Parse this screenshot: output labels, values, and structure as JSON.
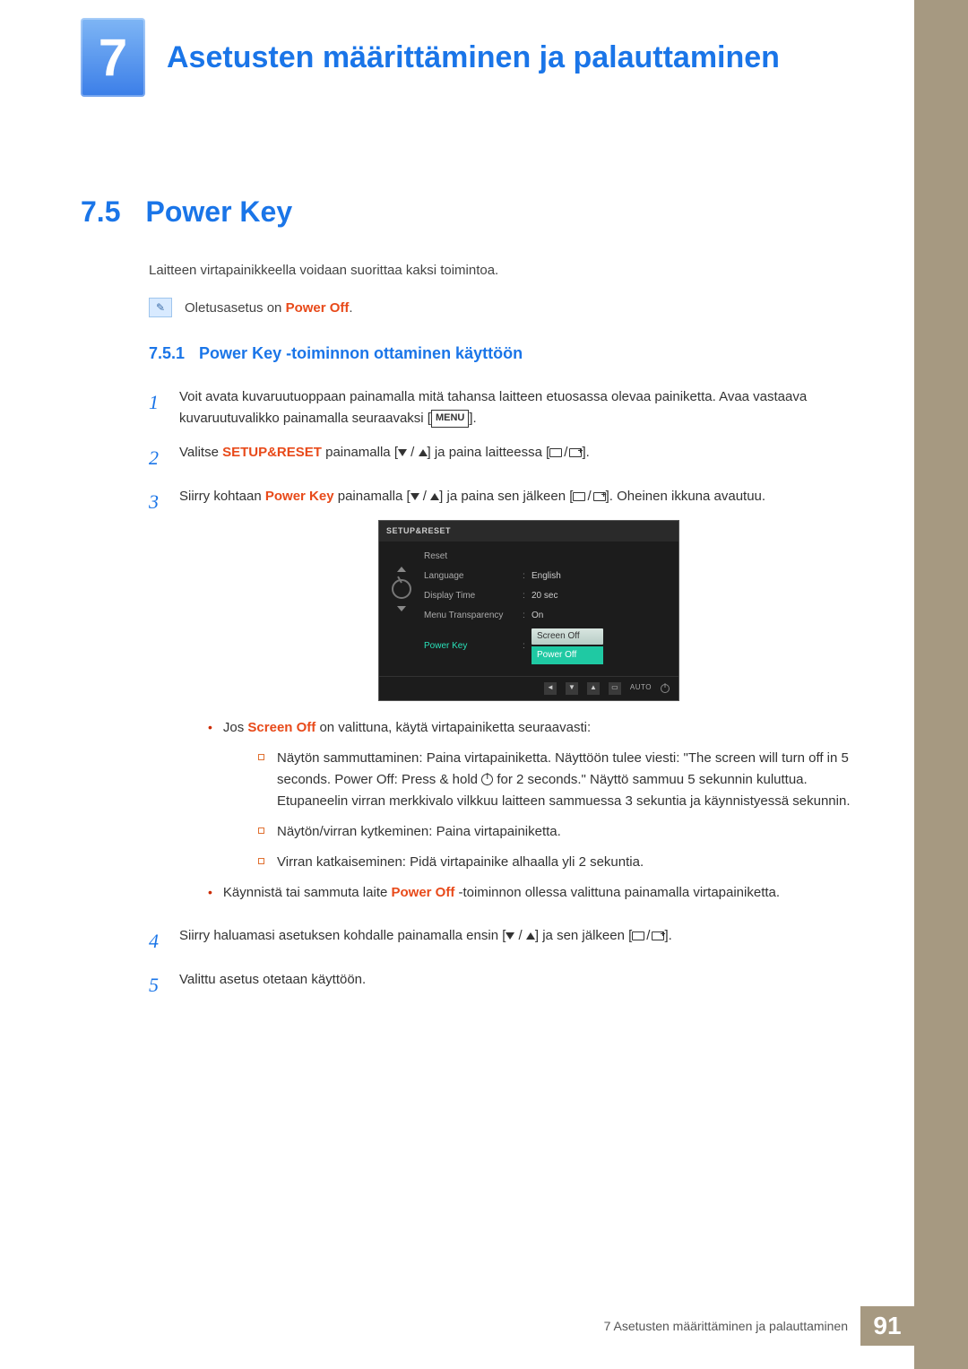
{
  "header": {
    "chapter_number": "7",
    "chapter_title": "Asetusten määrittäminen ja palauttaminen"
  },
  "section": {
    "number": "7.5",
    "title": "Power Key"
  },
  "intro_paragraph": "Laitteen virtapainikkeella voidaan suorittaa kaksi toimintoa.",
  "note": {
    "prefix": "Oletusasetus on ",
    "highlight": "Power Off",
    "suffix": "."
  },
  "subsection": {
    "number": "7.5.1",
    "title": "Power Key -toiminnon ottaminen käyttöön"
  },
  "steps": {
    "s1": {
      "num": "1",
      "text_a": "Voit avata kuvaruutuoppaan painamalla mitä tahansa laitteen etuosassa olevaa painiketta. Avaa vastaava kuvaruutuvalikko painamalla seuraavaksi [",
      "menu": "MENU",
      "text_b": "]."
    },
    "s2": {
      "num": "2",
      "text_a": "Valitse ",
      "bold": "SETUP&RESET",
      "text_b": " painamalla [",
      "text_c": "] ja paina laitteessa [",
      "text_d": "]."
    },
    "s3": {
      "num": "3",
      "text_a": "Siirry kohtaan ",
      "highlight": "Power Key",
      "text_b": " painamalla [",
      "text_c": "] ja paina sen jälkeen [",
      "text_d": "]. Oheinen ikkuna avautuu."
    },
    "s4": {
      "num": "4",
      "text_a": "Siirry haluamasi asetuksen kohdalle painamalla ensin [",
      "text_b": "] ja sen jälkeen [",
      "text_c": "]."
    },
    "s5": {
      "num": "5",
      "text": "Valittu asetus otetaan käyttöön."
    }
  },
  "osd": {
    "title": "SETUP&RESET",
    "rows": {
      "reset": "Reset",
      "language_label": "Language",
      "language_value": "English",
      "display_time_label": "Display Time",
      "display_time_value": "20 sec",
      "transparency_label": "Menu Transparency",
      "transparency_value": "On",
      "powerkey_label": "Power Key",
      "powerkey_value": "Screen Off",
      "poweroff_option": "Power Off"
    },
    "auto": "AUTO"
  },
  "bullets": {
    "b1": {
      "prefix": "Jos ",
      "highlight": "Screen Off",
      "suffix": " on valittuna, käytä virtapainiketta seuraavasti:"
    },
    "sb1": {
      "a": "Näytön sammuttaminen: Paina virtapainiketta. Näyttöön tulee viesti: \"The screen will turn off in 5 seconds. Power Off: Press & hold ",
      "b": " for 2 seconds.\" Näyttö sammuu 5 sekunnin kuluttua. Etupaneelin virran merkkivalo vilkkuu laitteen sammuessa 3 sekuntia ja käynnistyessä sekunnin."
    },
    "sb2": "Näytön/virran kytkeminen: Paina virtapainiketta.",
    "sb3": "Virran katkaiseminen: Pidä virtapainike alhaalla yli 2 sekuntia.",
    "b2": {
      "prefix": "Käynnistä tai sammuta laite ",
      "highlight": "Power Off",
      "suffix": " -toiminnon ollessa valittuna painamalla virtapainiketta."
    }
  },
  "footer": {
    "text": "7 Asetusten määrittäminen ja palauttaminen",
    "page": "91"
  }
}
